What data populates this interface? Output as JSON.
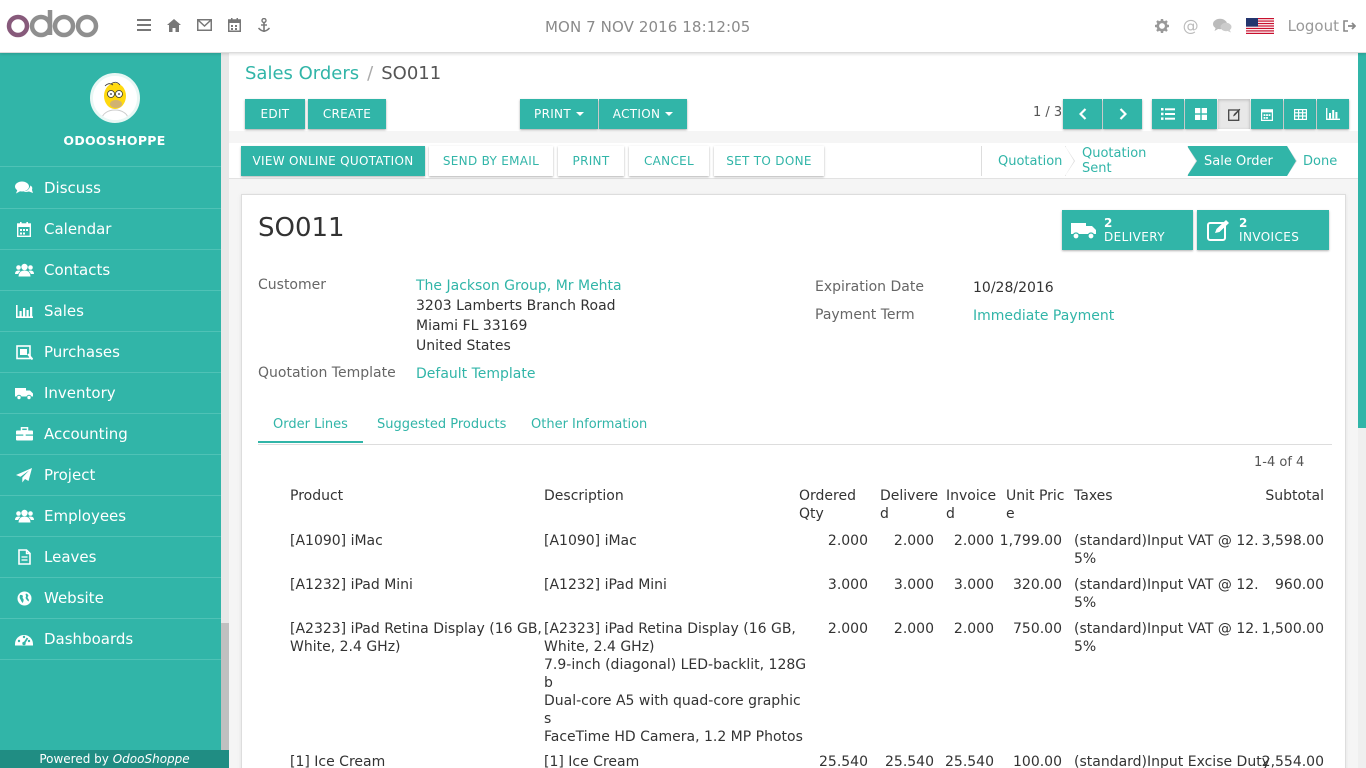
{
  "header": {
    "brand": "odoo",
    "datetime": "MON 7 NOV 2016 18:12:05",
    "logout_label": "Logout",
    "left_icons": [
      "menu-icon",
      "home-icon",
      "envelope-icon",
      "calendar-icon",
      "anchor-icon"
    ],
    "right_icons": [
      "gear-icon",
      "at-icon",
      "chat-icon",
      "us-flag-icon"
    ]
  },
  "sidebar": {
    "company": "ODOOSHOPPE",
    "items": [
      {
        "label": "Discuss",
        "icon": "comments-icon"
      },
      {
        "label": "Calendar",
        "icon": "calendar-icon"
      },
      {
        "label": "Contacts",
        "icon": "users-icon"
      },
      {
        "label": "Sales",
        "icon": "bar-chart-icon"
      },
      {
        "label": "Purchases",
        "icon": "purchase-icon"
      },
      {
        "label": "Inventory",
        "icon": "truck-icon"
      },
      {
        "label": "Accounting",
        "icon": "briefcase-icon"
      },
      {
        "label": "Project",
        "icon": "paper-plane-icon"
      },
      {
        "label": "Employees",
        "icon": "users-icon"
      },
      {
        "label": "Leaves",
        "icon": "file-icon"
      },
      {
        "label": "Website",
        "icon": "globe-icon"
      },
      {
        "label": "Dashboards",
        "icon": "dashboard-icon"
      }
    ],
    "powered_prefix": "Powered by",
    "powered_name": "OdooShoppe"
  },
  "breadcrumb": {
    "parent": "Sales Orders",
    "separator": "/",
    "current": "SO011"
  },
  "toolbar": {
    "edit": "EDIT",
    "create": "CREATE",
    "print": "PRINT",
    "action": "ACTION",
    "pager": "1 / 3"
  },
  "statusbar": {
    "buttons": [
      "VIEW ONLINE QUOTATION",
      "SEND BY EMAIL",
      "PRINT",
      "CANCEL",
      "SET TO DONE"
    ],
    "stages": [
      "Quotation",
      "Quotation Sent",
      "Sale Order",
      "Done"
    ],
    "active_stage": "Sale Order"
  },
  "record": {
    "title": "SO011",
    "smart_buttons": [
      {
        "count": "2",
        "label": "DELIVERY",
        "icon": "truck-icon"
      },
      {
        "count": "2",
        "label": "INVOICES",
        "icon": "edit-icon"
      }
    ],
    "customer_label": "Customer",
    "customer_name": "The Jackson Group, Mr Mehta",
    "address": [
      "3203 Lamberts Branch Road",
      "Miami FL 33169",
      "United States"
    ],
    "template_label": "Quotation Template",
    "template_value": "Default Template",
    "expiration_label": "Expiration Date",
    "expiration_value": "10/28/2016",
    "payment_label": "Payment Term",
    "payment_value": "Immediate Payment"
  },
  "tabs": [
    "Order Lines",
    "Suggested Products",
    "Other Information"
  ],
  "lines": {
    "count": "1-4 of 4",
    "headers": {
      "product": "Product",
      "description": "Description",
      "ordered": [
        "Ordered",
        "Qty"
      ],
      "delivered": [
        "Delivere",
        "d"
      ],
      "invoiced": [
        "Invoice",
        "d"
      ],
      "price": [
        "Unit Pric",
        "e"
      ],
      "taxes": "Taxes",
      "subtotal": "Subtotal"
    },
    "rows": [
      {
        "product": [
          "[A1090] iMac"
        ],
        "description": [
          "[A1090] iMac"
        ],
        "ordered": "2.000",
        "delivered": "2.000",
        "invoiced": "2.000",
        "price": "1,799.00",
        "taxes": [
          "(standard)Input VAT @ 12.",
          "5%"
        ],
        "subtotal": "3,598.00"
      },
      {
        "product": [
          "[A1232] iPad Mini"
        ],
        "description": [
          "[A1232] iPad Mini"
        ],
        "ordered": "3.000",
        "delivered": "3.000",
        "invoiced": "3.000",
        "price": "320.00",
        "taxes": [
          "(standard)Input VAT @ 12.",
          "5%"
        ],
        "subtotal": "960.00"
      },
      {
        "product": [
          "[A2323] iPad Retina Display (16 GB,",
          "White, 2.4 GHz)"
        ],
        "description": [
          "[A2323] iPad Retina Display (16 GB,",
          "White, 2.4 GHz)",
          "7.9-inch (diagonal) LED-backlit, 128G",
          "b",
          "Dual-core A5 with quad-core graphic",
          "s",
          "FaceTime HD Camera, 1.2 MP Photos"
        ],
        "ordered": "2.000",
        "delivered": "2.000",
        "invoiced": "2.000",
        "price": "750.00",
        "taxes": [
          "(standard)Input VAT @ 12.",
          "5%"
        ],
        "subtotal": "1,500.00"
      },
      {
        "product": [
          "[1] Ice Cream"
        ],
        "description": [
          "[1] Ice Cream"
        ],
        "ordered": "25.540",
        "delivered": "25.540",
        "invoiced": "25.540",
        "price": "100.00",
        "taxes": [
          "(standard)Input Excise Duty"
        ],
        "subtotal": "2,554.00"
      }
    ]
  },
  "colors": {
    "accent": "#31b5a8",
    "sidebar": "#31b5a8",
    "brand_purple": "#875a7b",
    "brand_grey": "#8f8f8f"
  }
}
